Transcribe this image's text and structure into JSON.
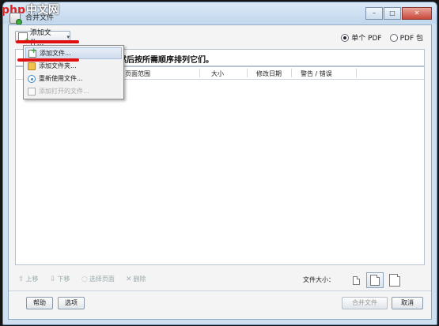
{
  "window": {
    "title": "合并文件",
    "watermark": "php",
    "watermark_cn": "中文网",
    "controls": {
      "minimize": "–",
      "maximize": "□",
      "close": "✕"
    }
  },
  "toolbar": {
    "add_files_label": "添加文件...",
    "caret": "▾",
    "radio_single_pdf": "单个 PDF",
    "radio_pdf_package": "PDF 包",
    "selected_radio": "单个 PDF"
  },
  "instruction": "然后按所需顺序排列它们。",
  "columns": [
    "页面范围",
    "大小",
    "修改日期",
    "警告 / 错误"
  ],
  "menu": {
    "items": [
      {
        "label": "添加文件...",
        "state": "highlighted",
        "icon": "add-file-icon"
      },
      {
        "label": "添加文件夹...",
        "state": "normal",
        "icon": "folder-icon"
      },
      {
        "label": "重新使用文件...",
        "state": "normal",
        "icon": "reuse-icon"
      },
      {
        "label": "添加打开的文件...",
        "state": "disabled",
        "icon": "open-files-icon"
      }
    ]
  },
  "bottom_toolbar": {
    "move_up": "上移",
    "move_down": "下移",
    "choose_pages": "选择页面",
    "delete": "删除",
    "file_size_label": "文件大小："
  },
  "footer": {
    "help": "帮助",
    "options": "选项",
    "combine": "合并文件",
    "cancel": "取消"
  },
  "colors": {
    "annotation_red": "#e01010",
    "menu_highlight": "#cfdced",
    "window_frame": "#cfe0f0"
  }
}
